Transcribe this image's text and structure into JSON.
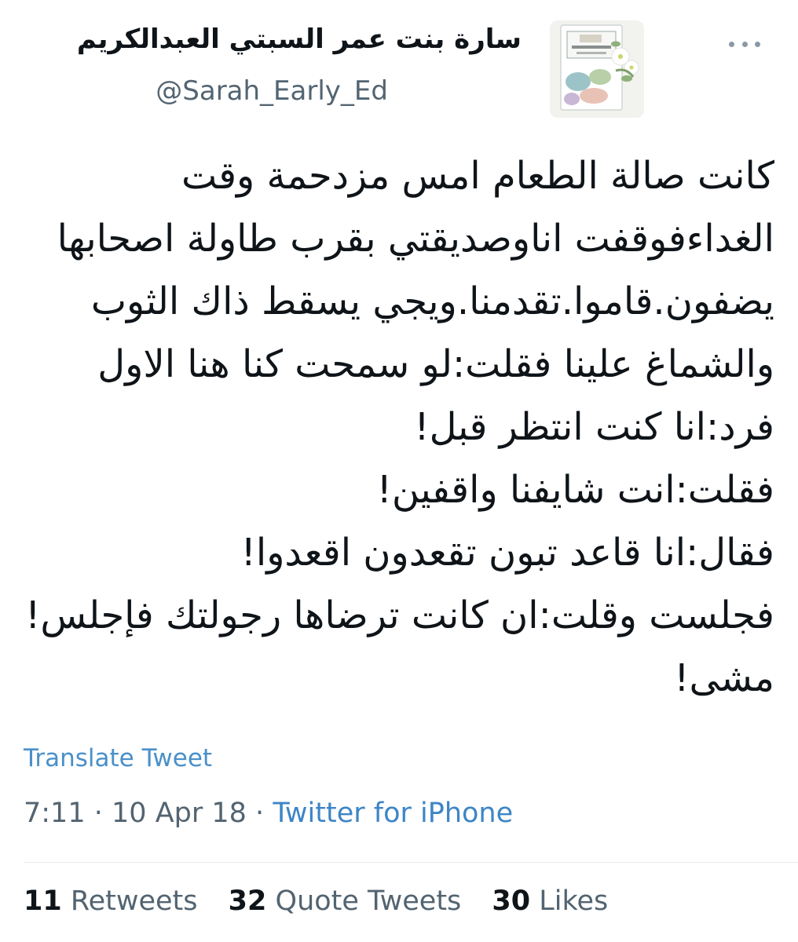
{
  "tweet": {
    "author": {
      "display_name": "سارة بنت عمر السبتي العبدالكريم",
      "handle": "@Sarah_Early_Ed",
      "avatar_icon": "book-cover-avatar"
    },
    "more_icon": "more-options-icon",
    "text_lines": [
      "كانت صالة الطعام امس مزدحمة وقت",
      "الغداءفوقفت اناوصديقتي بقرب طاولة اصحابها",
      "يضفون.قاموا.تقدمنا.ويجي يسقط ذاك الثوب",
      "والشماغ علينا فقلت:لو سمحت كنا هنا الاول",
      "فرد:انا كنت انتظر قبل!",
      "فقلت:انت شايفنا واقفين!",
      "فقال:انا قاعد تبون تقعدون اقعدوا!",
      "فجلست وقلت:ان كانت ترضاها رجولتك فإجلس!",
      "مشى!"
    ],
    "translate_label": "Translate Tweet",
    "time": "7:11",
    "separator": "·",
    "date": "10 Apr 18",
    "source": "Twitter for iPhone",
    "stats": {
      "retweets_count": "11",
      "retweets_label": "Retweets",
      "quotes_count": "32",
      "quotes_label": "Quote Tweets",
      "likes_count": "30",
      "likes_label": "Likes"
    },
    "colors": {
      "link": "#4a90c9",
      "muted": "#536471",
      "text": "#0f1419"
    }
  }
}
